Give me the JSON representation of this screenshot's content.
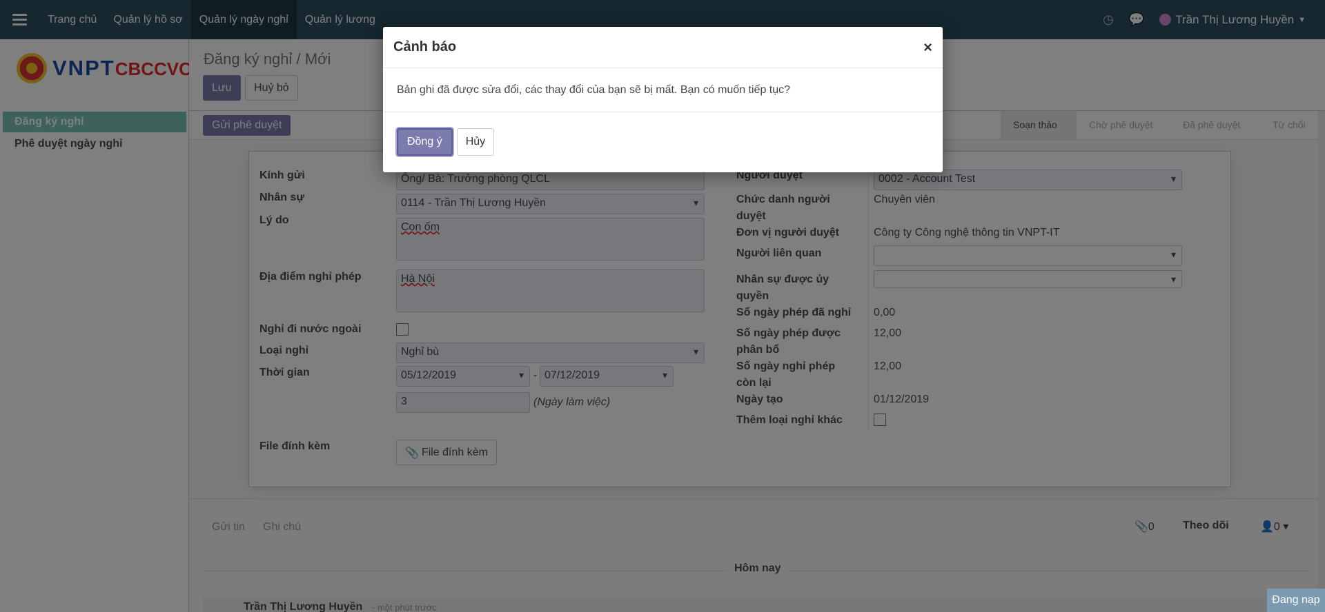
{
  "topbar": {
    "menu": [
      "Trang chủ",
      "Quản lý hồ sơ",
      "Quản lý ngày nghỉ",
      "Quản lý lương"
    ],
    "active_index": 2,
    "user_name": "Trần Thị Lương Huyền"
  },
  "sidebar": {
    "logo_main": "VNPT",
    "logo_sub": "CBCCVC",
    "items": [
      {
        "label": "Đăng ký nghỉ",
        "active": true
      },
      {
        "label": "Phê duyệt ngày nghỉ",
        "active": false
      }
    ]
  },
  "control_panel": {
    "breadcrumb": "Đăng ký nghỉ / Mới",
    "save_label": "Lưu",
    "discard_label": "Huỷ bỏ",
    "submit_label": "Gửi phê duyệt"
  },
  "statusbar": {
    "stages": [
      "Soạn thảo",
      "Chờ phê duyệt",
      "Đã phê duyệt",
      "Từ chối"
    ],
    "active": "Soạn thảo"
  },
  "form": {
    "left": {
      "kinh_gui_label": "Kính gửi",
      "kinh_gui_value": "Ông/ Bà: Trưởng phòng QLCL",
      "nhan_su_label": "Nhân sự",
      "nhan_su_value": "0114 - Trần Thị Lương Huyền",
      "ly_do_label": "Lý do",
      "ly_do_value": "Con ốm",
      "dia_diem_label": "Địa điểm nghỉ phép",
      "dia_diem_value": "Hà Nội",
      "nuoc_ngoai_label": "Nghỉ đi nước ngoài",
      "loai_nghi_label": "Loại nghỉ",
      "loai_nghi_value": "Nghỉ bù",
      "thoi_gian_label": "Thời gian",
      "date_from": "05/12/2019",
      "date_sep": "-",
      "date_to": "07/12/2019",
      "days": "3",
      "days_unit": "(Ngày làm việc)",
      "file_label": "File đính kèm",
      "file_button": "File đính kèm"
    },
    "right": {
      "nguoi_duyet_label": "Người duyệt",
      "nguoi_duyet_value": "0002 - Account Test",
      "chuc_danh_label_1": "Chức danh người",
      "chuc_danh_label_2": "duyệt",
      "chuc_danh_value": "Chuyên viên",
      "don_vi_label": "Đơn vị người duyệt",
      "don_vi_value": "Công ty Công nghệ thông tin VNPT-IT",
      "lien_quan_label": "Người liên quan",
      "uy_quyen_label_1": "Nhân sự được ủy",
      "uy_quyen_label_2": "quyền",
      "da_nghi_label": "Số ngày phép đã nghỉ",
      "da_nghi_value": "0,00",
      "phan_bo_label_1": "Số ngày phép được",
      "phan_bo_label_2": "phân bổ",
      "phan_bo_value": "12,00",
      "con_lai_label_1": "Số ngày nghỉ phép",
      "con_lai_label_2": "còn lại",
      "con_lai_value": "12,00",
      "ngay_tao_label": "Ngày tạo",
      "ngay_tao_value": "01/12/2019",
      "them_loai_label": "Thêm loại nghỉ khác"
    }
  },
  "chatter": {
    "send_message": "Gửi tin",
    "log_note": "Ghi chú",
    "attachments": "0",
    "follow": "Theo dõi",
    "followers": "0",
    "today": "Hôm nay",
    "author": "Trần Thị Lương Huyền",
    "time": "- một phút trước"
  },
  "dialog": {
    "title": "Cảnh báo",
    "close": "×",
    "message": "Bản ghi đã được sửa đổi, các thay đổi của bạn sẽ bị mất. Bạn có muốn tiếp tục?",
    "ok_label": "Đồng ý",
    "cancel_label": "Hủy"
  },
  "loading_label": "Đang nạp"
}
